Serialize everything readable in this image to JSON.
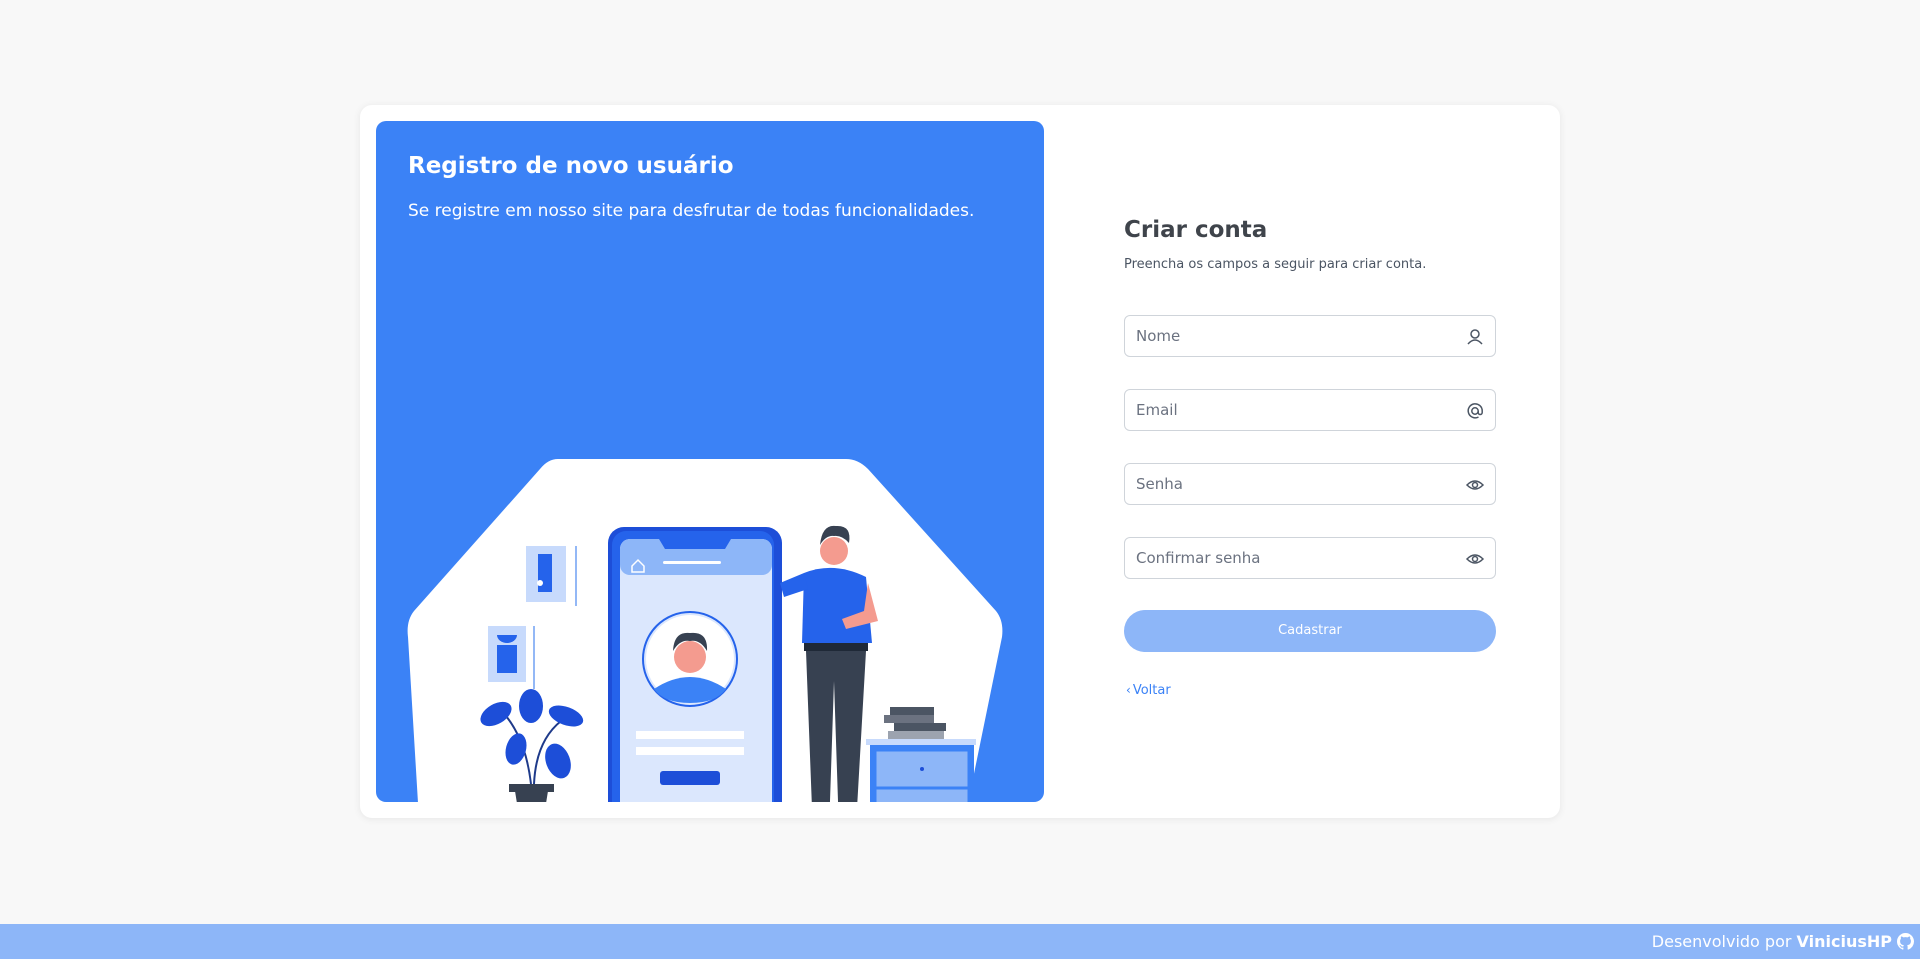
{
  "hero": {
    "title": "Registro de novo usuário",
    "subtitle": "Se registre em nosso site para desfrutar de todas funcionalidades."
  },
  "form": {
    "title": "Criar conta",
    "subtitle": "Preencha os campos a seguir para criar conta.",
    "fields": [
      {
        "placeholder": "Nome",
        "value": "",
        "icon": "user-icon"
      },
      {
        "placeholder": "Email",
        "value": "",
        "icon": "at-icon"
      },
      {
        "placeholder": "Senha",
        "value": "",
        "icon": "eye-icon"
      },
      {
        "placeholder": "Confirmar senha",
        "value": "",
        "icon": "eye-icon"
      }
    ],
    "submit_label": "Cadastrar",
    "back_label": "Voltar"
  },
  "footer": {
    "prefix": "Desenvolvido por",
    "author": "ViniciusHP",
    "icon": "github-icon"
  },
  "colors": {
    "primary": "#3b82f6",
    "primary_light": "#8db6f8",
    "background": "#f8f8f8",
    "card": "#ffffff"
  }
}
